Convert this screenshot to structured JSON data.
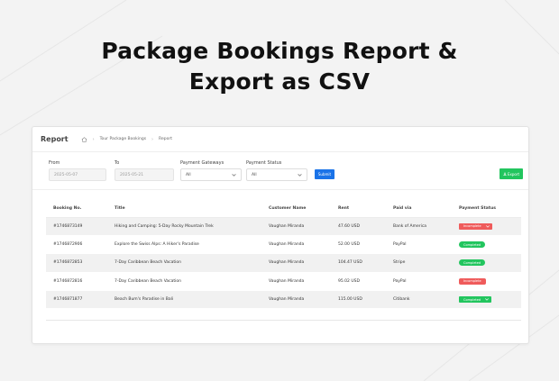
{
  "hero": {
    "line1": "Package Bookings Report &",
    "line2": "Export as CSV"
  },
  "page": {
    "title": "Report"
  },
  "breadcrumb": {
    "item1": "Tour Package Bookings",
    "item2": "Report"
  },
  "filters": {
    "from_label": "From",
    "from_value": "2025-05-07",
    "to_label": "To",
    "to_value": "2025-05-21",
    "gateway_label": "Payment Gateways",
    "gateway_value": "All",
    "status_label": "Payment Status",
    "status_value": "All",
    "submit_label": "Submit",
    "export_label": "Export"
  },
  "table": {
    "headers": [
      "Booking No.",
      "Title",
      "Customer Name",
      "Rent",
      "Paid via",
      "Payment Status"
    ],
    "rows": [
      {
        "booking": "#1746873149",
        "title": "Hiking and Camping: 5-Day Rocky Mountain Trek",
        "customer": "Vaughan Miranda",
        "rent": "47.60 USD",
        "paid": "Bank of America",
        "status": "Incomplete",
        "status_color": "#ef5b5b",
        "status_type": "select"
      },
      {
        "booking": "#1746872906",
        "title": "Explore the Swiss Alps: A Hiker's Paradise",
        "customer": "Vaughan Miranda",
        "rent": "52.00 USD",
        "paid": "PayPal",
        "status": "Completed",
        "status_color": "#22c55e",
        "status_type": "pill"
      },
      {
        "booking": "#1746872853",
        "title": "7-Day Caribbean Beach Vacation",
        "customer": "Vaughan Miranda",
        "rent": "104.47 USD",
        "paid": "Stripe",
        "status": "Completed",
        "status_color": "#22c55e",
        "status_type": "pill"
      },
      {
        "booking": "#1746872816",
        "title": "7-Day Caribbean Beach Vacation",
        "customer": "Vaughan Miranda",
        "rent": "95.02 USD",
        "paid": "PayPal",
        "status": "Incomplete",
        "status_color": "#ef5b5b",
        "status_type": "pill"
      },
      {
        "booking": "#1746871877",
        "title": "Beach Bum's Paradise in Bali",
        "customer": "Vaughan Miranda",
        "rent": "115.00 USD",
        "paid": "Citibank",
        "status": "Completed",
        "status_color": "#22c55e",
        "status_type": "select"
      }
    ]
  },
  "colors": {
    "primary": "#1a73e8",
    "success": "#22c55e",
    "danger": "#ef5b5b"
  }
}
